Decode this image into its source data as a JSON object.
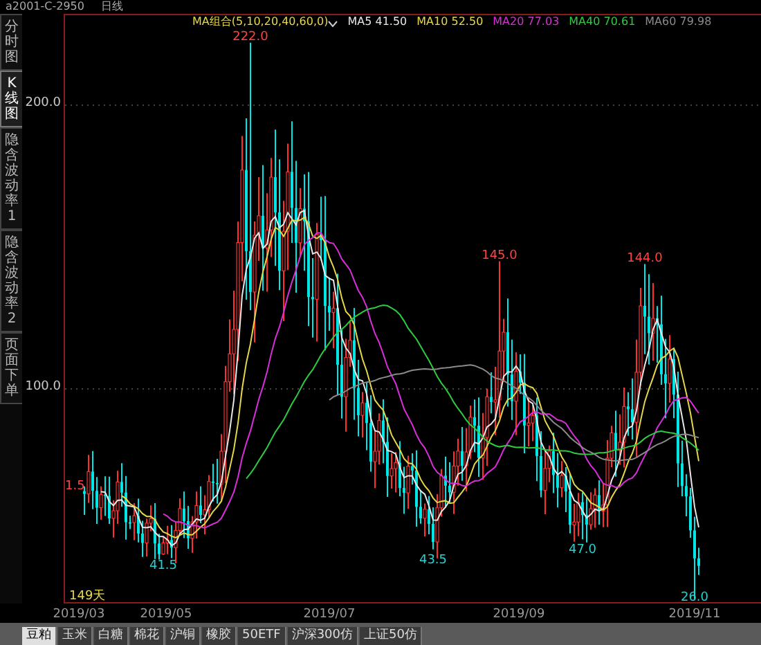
{
  "top_bar": {
    "contract": "a2001-C-2950",
    "period": "日线"
  },
  "side_tabs": [
    {
      "label": "分时图",
      "selected": false
    },
    {
      "label": "K线图",
      "selected": true
    },
    {
      "label": "隐含波动率1",
      "selected": false
    },
    {
      "label": "隐含波动率2",
      "selected": false
    },
    {
      "label": "页面下单",
      "selected": false
    }
  ],
  "indicator": {
    "label": "MA组合(5,10,20,40,60,0)",
    "lines": [
      {
        "label": "MA5 41.50",
        "color": "#e8e8e8"
      },
      {
        "label": "MA10 52.50",
        "color": "#e6d84a"
      },
      {
        "label": "MA20 77.03",
        "color": "#d92ed9"
      },
      {
        "label": "MA40 70.61",
        "color": "#2ecc40"
      },
      {
        "label": "MA60 79.98",
        "color": "#8a8a8a"
      }
    ]
  },
  "y_axis": [
    "200.0",
    "100.0"
  ],
  "price_marks": [
    {
      "text": "222.0",
      "kind": "high"
    },
    {
      "text": "145.0",
      "kind": "high"
    },
    {
      "text": "144.0",
      "kind": "high"
    },
    {
      "text": "41.5",
      "kind": "low"
    },
    {
      "text": "43.5",
      "kind": "low"
    },
    {
      "text": "47.0",
      "kind": "low"
    },
    {
      "text": "26.0",
      "kind": "low"
    },
    {
      "text": "1.5",
      "kind": "high"
    }
  ],
  "day_count": "149天",
  "dates": [
    "2019/03",
    "2019/05",
    "2019/07",
    "2019/09",
    "2019/11"
  ],
  "bottom_tabs": [
    {
      "label": "豆粕",
      "selected": true
    },
    {
      "label": "玉米",
      "selected": false
    },
    {
      "label": "白糖",
      "selected": false
    },
    {
      "label": "棉花",
      "selected": false
    },
    {
      "label": "沪铜",
      "selected": false
    },
    {
      "label": "橡胶",
      "selected": false
    },
    {
      "label": "50ETF",
      "selected": false
    },
    {
      "label": "沪深300仿",
      "selected": false
    },
    {
      "label": "上证50仿",
      "selected": false
    }
  ]
}
